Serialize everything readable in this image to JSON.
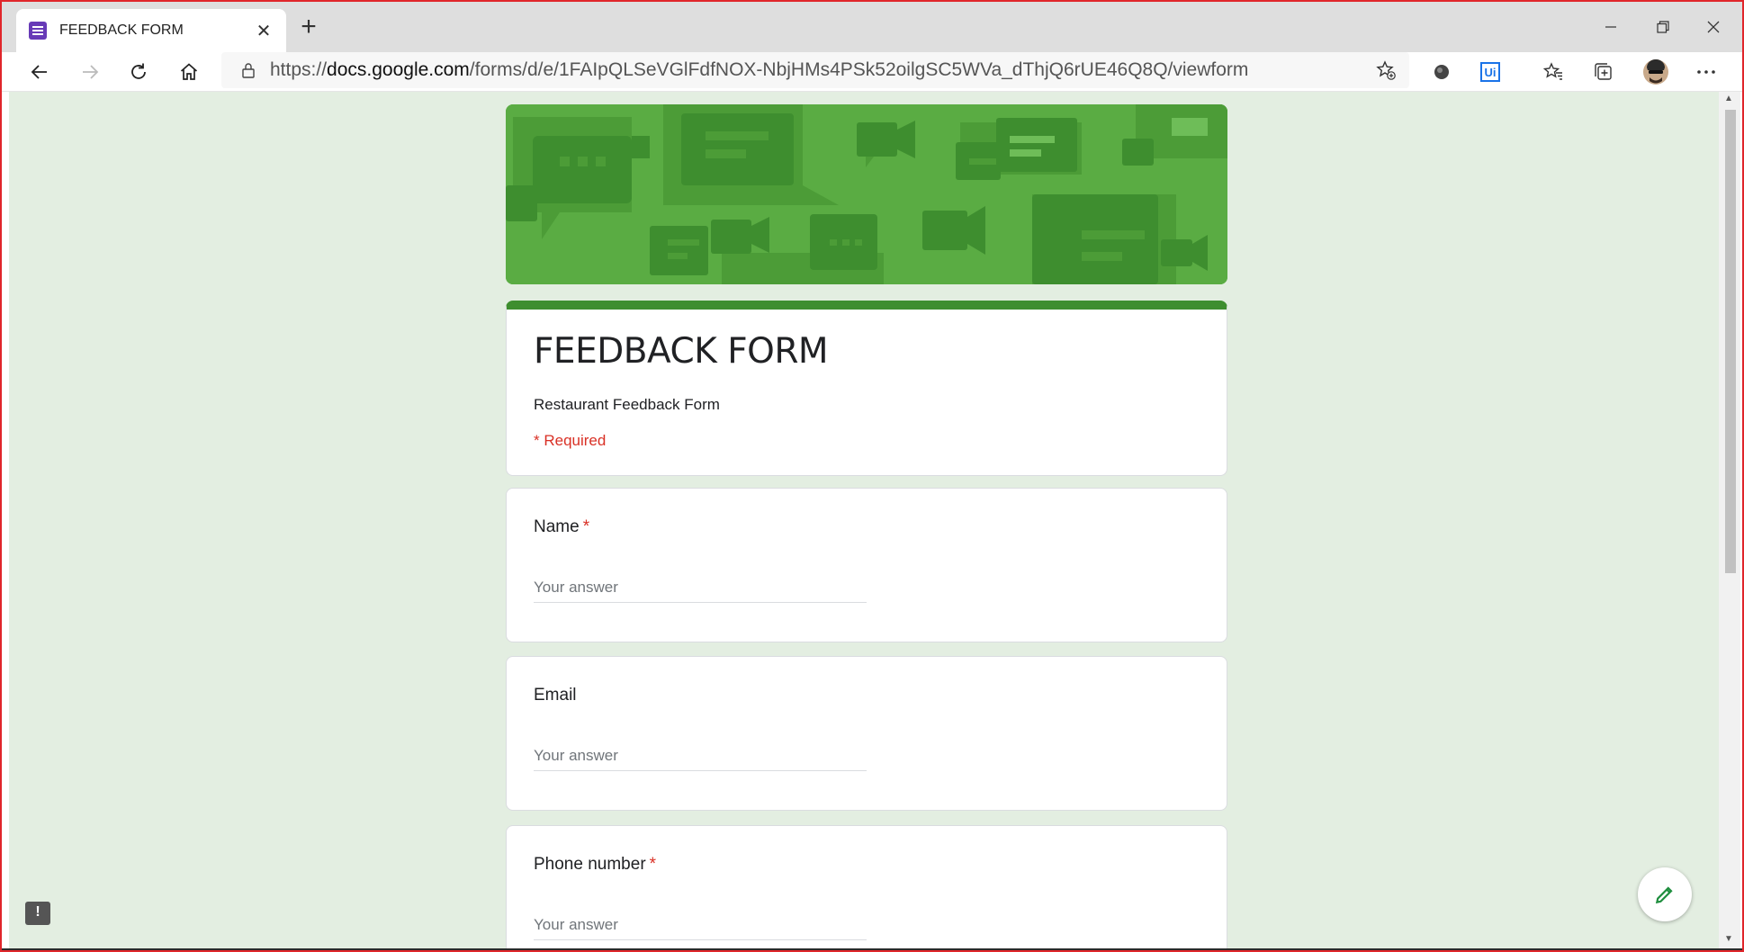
{
  "browser": {
    "tab_title": "FEEDBACK FORM",
    "tab_close": "✕",
    "new_tab": "+",
    "url_prefix": "https://",
    "url_host": "docs.google.com",
    "url_path": "/forms/d/e/1FAIpQLSeVGlFdfNOX-NbjHMs4PSk52oilgSC5WVa_dThjQ6rUE46Q8Q/viewform",
    "ext_label": "Ui"
  },
  "form": {
    "title": "FEEDBACK FORM",
    "description": "Restaurant Feedback Form",
    "required_note": "* Required",
    "questions": [
      {
        "label": "Name",
        "required_mark": "*",
        "placeholder": "Your answer"
      },
      {
        "label": "Email",
        "required_mark": "",
        "placeholder": "Your answer"
      },
      {
        "label": "Phone number",
        "required_mark": "*",
        "placeholder": "Your answer"
      }
    ]
  },
  "feedback_button": "!",
  "colors": {
    "theme_green": "#3e8e2f",
    "banner_green": "#5aac43",
    "page_background": "#e3eee1",
    "required_red": "#d93025",
    "form_icon_purple": "#673ab7"
  }
}
